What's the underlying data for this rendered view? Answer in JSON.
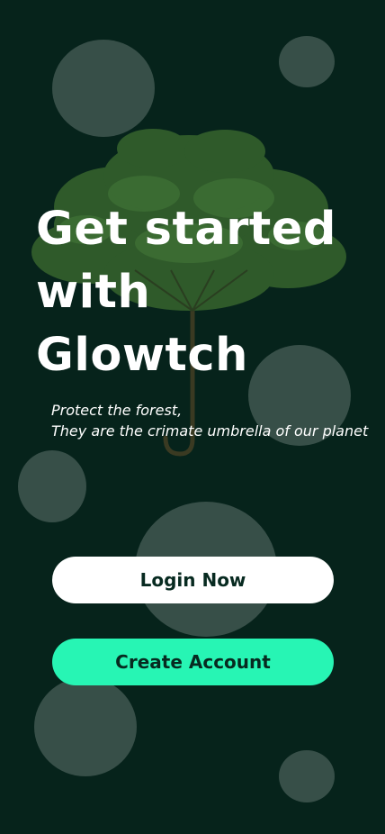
{
  "hero": {
    "title": "Get started\nwith Glowtch",
    "subtitle_line1": "Protect the forest,",
    "subtitle_line2": "They are the crimate umbrella of our planet",
    "illustration_icon": "tree-umbrella-icon"
  },
  "actions": {
    "login_label": "Login Now",
    "create_label": "Create Account"
  },
  "colors": {
    "background": "#06231b",
    "accent": "#27f5b4",
    "login_button": "#ffffff",
    "button_text": "#072a20"
  }
}
